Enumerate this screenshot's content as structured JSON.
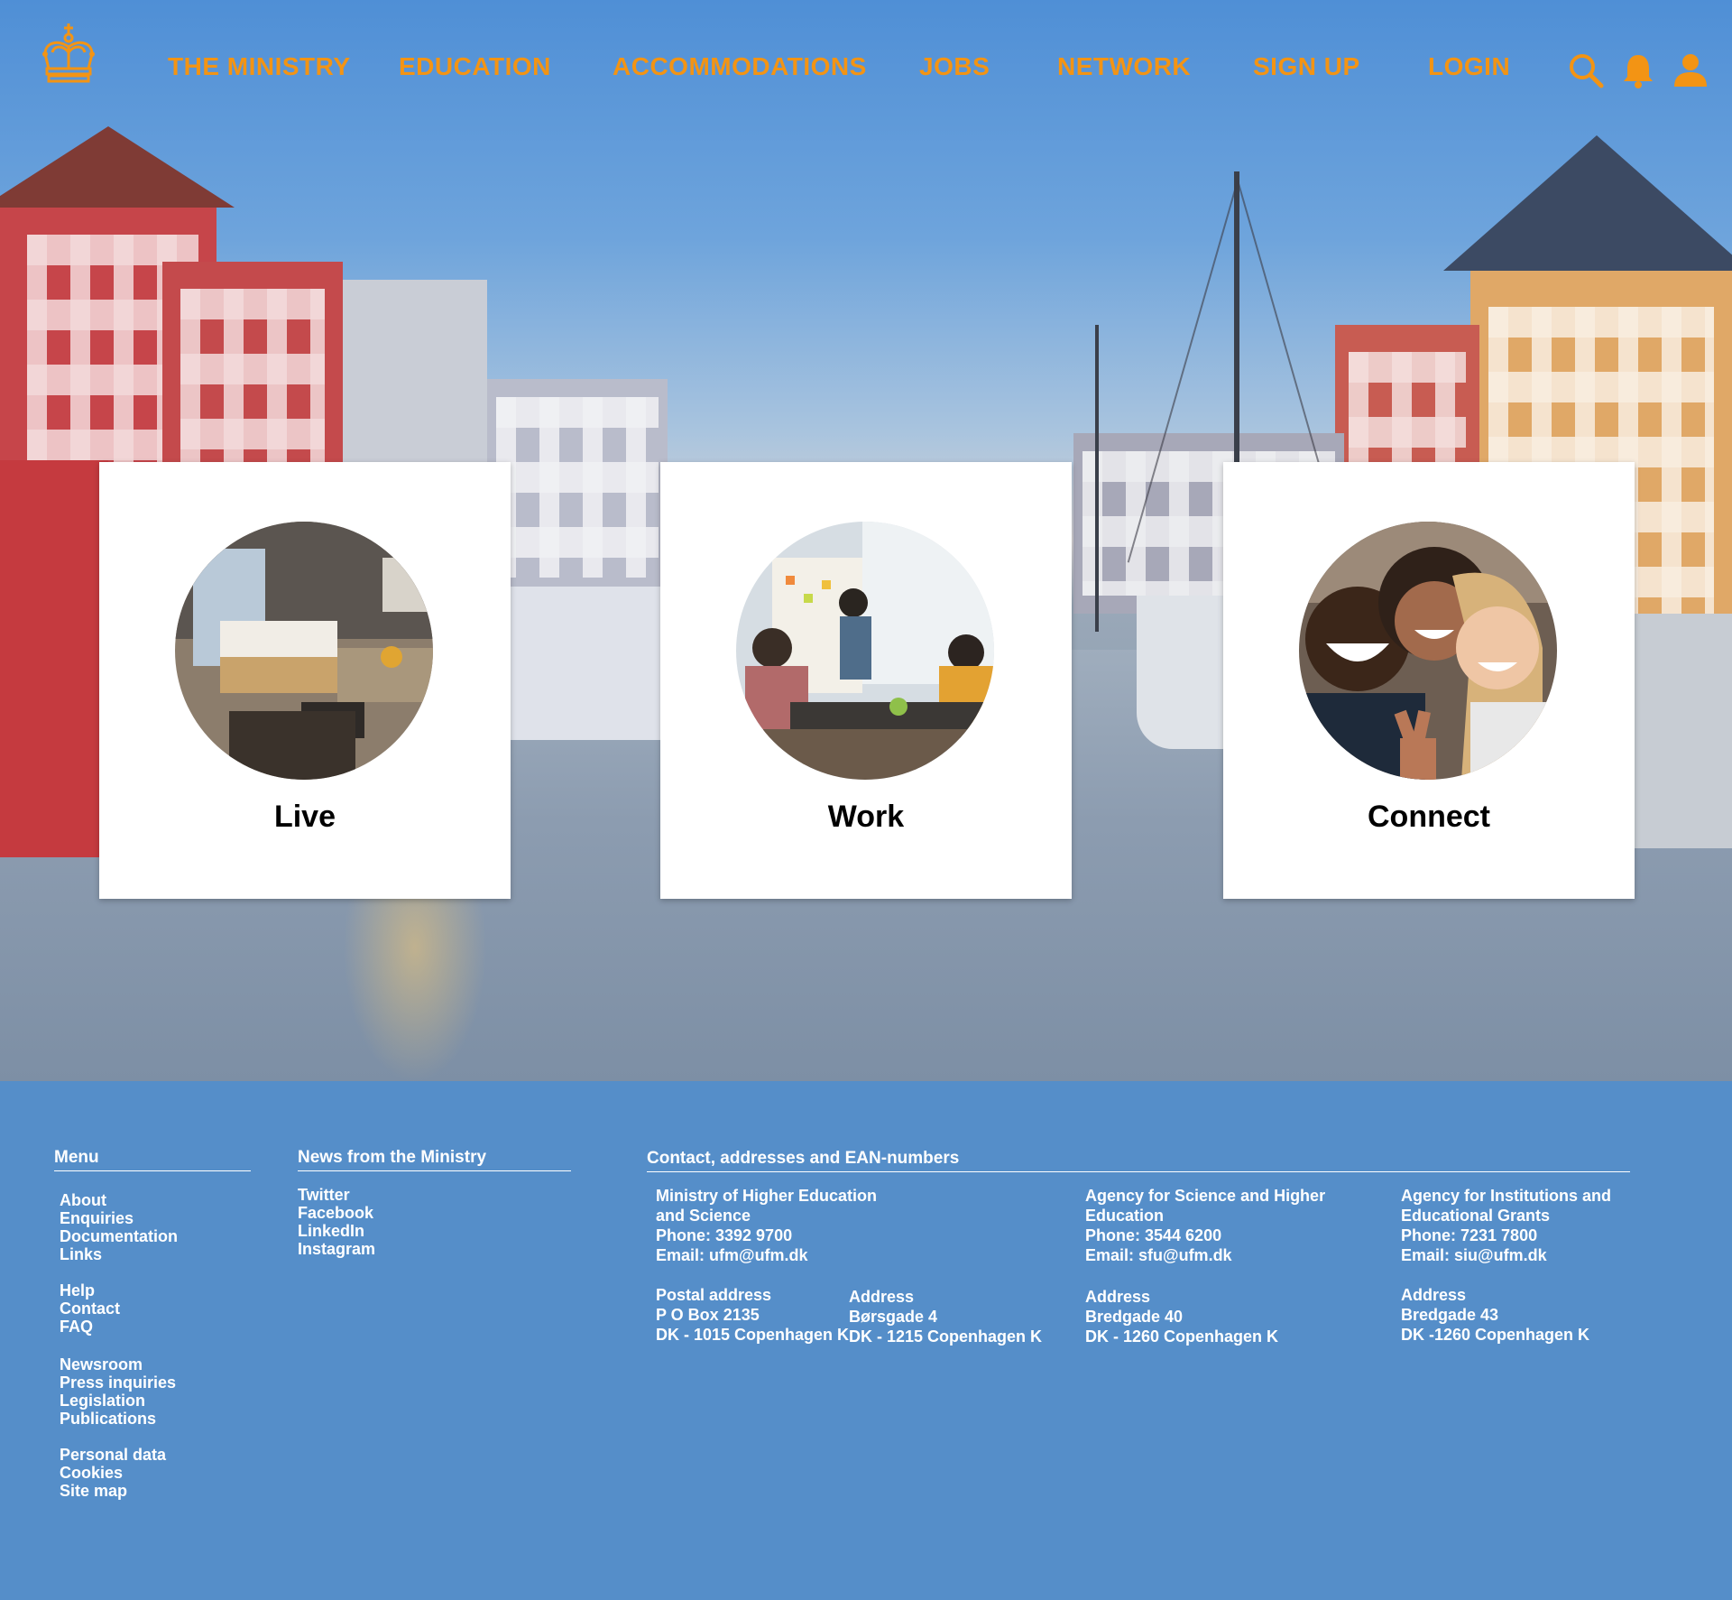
{
  "nav": {
    "items": [
      "THE MINISTRY",
      "EDUCATION",
      "ACCOMMODATIONS",
      "JOBS",
      "NETWORK",
      "SIGN UP",
      "LOGIN"
    ],
    "accent_color": "#f39414",
    "icons": [
      "crown-logo-icon",
      "search-icon",
      "bell-icon",
      "user-icon"
    ]
  },
  "cards": [
    {
      "label": "Live",
      "image": "hotel-room-photo"
    },
    {
      "label": "Work",
      "image": "office-meeting-photo"
    },
    {
      "label": "Connect",
      "image": "friends-selfie-photo"
    }
  ],
  "footer": {
    "background_color": "#558ec9",
    "menu": {
      "heading": "Menu",
      "groups": [
        [
          "About",
          "Enquiries",
          "Documentation",
          "Links"
        ],
        [
          "Help",
          "Contact",
          "FAQ"
        ],
        [
          "Newsroom",
          "Press inquiries",
          "Legislation",
          "Publications"
        ],
        [
          "Personal data",
          "Cookies",
          "Site map"
        ]
      ]
    },
    "news": {
      "heading": "News from the Ministry",
      "links": [
        "Twitter",
        "Facebook",
        "LinkedIn",
        "Instagram"
      ]
    },
    "contact": {
      "heading": "Contact, addresses and EAN-numbers",
      "ministry": {
        "name_line1": "Ministry of Higher Education",
        "name_line2": "and Science",
        "phone": "Phone: 3392 9700",
        "email": "Email: ufm@ufm.dk",
        "postal_label": "Postal address",
        "postal_line1": "P O Box 2135",
        "postal_line2": "DK - 1015 Copenhagen K",
        "address_label": "Address",
        "address_line1": "Børsgade 4",
        "address_line2": "DK - 1215 Copenhagen K"
      },
      "agency_science": {
        "name_line1": "Agency for Science and Higher",
        "name_line2": "Education",
        "phone": "Phone: 3544 6200",
        "email": "Email: sfu@ufm.dk",
        "address_label": "Address",
        "address_line1": "Bredgade 40",
        "address_line2": "DK - 1260 Copenhagen K"
      },
      "agency_grants": {
        "name_line1": "Agency for Institutions and",
        "name_line2": "Educational Grants",
        "phone": "Phone: 7231 7800",
        "email": "Email: siu@ufm.dk",
        "address_label": "Address",
        "address_line1": "Bredgade 43",
        "address_line2": "DK -1260 Copenhagen K"
      }
    }
  }
}
